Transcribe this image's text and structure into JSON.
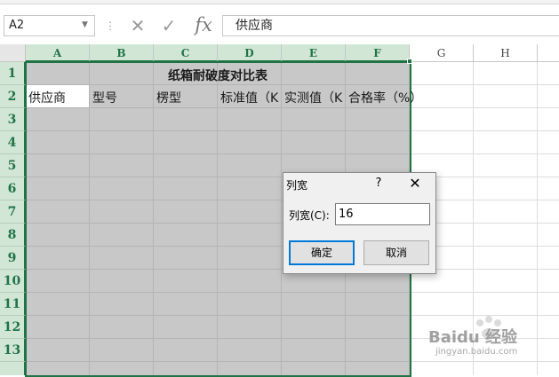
{
  "formula_bar": {
    "name_box": "A2",
    "formula": "供应商"
  },
  "columns": [
    "A",
    "B",
    "C",
    "D",
    "E",
    "F",
    "G",
    "H"
  ],
  "rows": [
    "1",
    "2",
    "3",
    "4",
    "5",
    "6",
    "7",
    "8",
    "9",
    "10",
    "11",
    "12",
    "13"
  ],
  "sheet": {
    "title": "纸箱耐破度对比表",
    "headers": [
      "供应商",
      "型号",
      "楞型",
      "标准值（K",
      "实测值（K",
      "合格率（%）"
    ]
  },
  "dialog": {
    "title": "列宽",
    "help": "?",
    "label": "列宽(C):",
    "value": "16",
    "ok": "确定",
    "cancel": "取消"
  },
  "watermark": {
    "brand": "Baidu 经验",
    "url": "jingyan.baidu.com"
  },
  "colors": {
    "accent": "#217346",
    "selection": "#c8c8c8",
    "dialog_focus": "#0078d7"
  }
}
